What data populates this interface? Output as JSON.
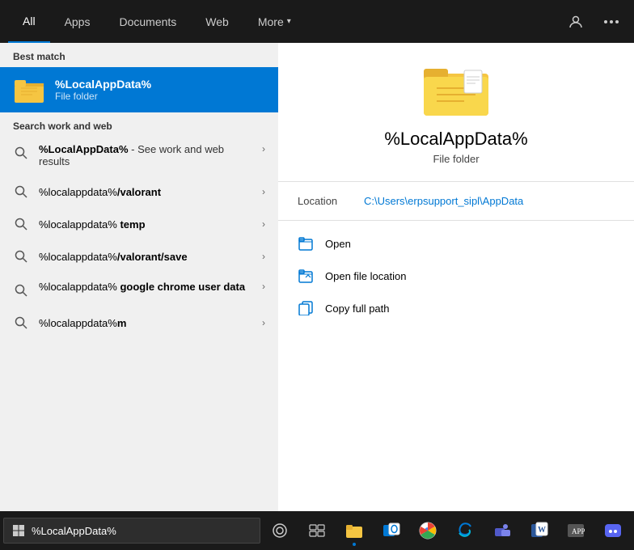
{
  "nav": {
    "tabs": [
      {
        "label": "All",
        "active": true
      },
      {
        "label": "Apps",
        "active": false
      },
      {
        "label": "Documents",
        "active": false
      },
      {
        "label": "Web",
        "active": false
      },
      {
        "label": "More",
        "active": false,
        "has_arrow": true
      }
    ],
    "icon_person": "👤",
    "icon_more": "···"
  },
  "best_match": {
    "section_label": "Best match",
    "item_name": "%LocalAppData%",
    "item_type": "File folder"
  },
  "search_section": {
    "label": "Search work and web",
    "items": [
      {
        "text": "%LocalAppData%",
        "suffix": " - See work and web results",
        "is_multi": true
      },
      {
        "text": "%localappdata%/valorant",
        "suffix": ""
      },
      {
        "text": "%localappdata% temp",
        "suffix": ""
      },
      {
        "text": "%localappdata%/valorant/save",
        "suffix": ""
      },
      {
        "text": "%localappdata% google chrome user data",
        "suffix": "",
        "bold_suffix": "google chrome user data",
        "is_multi": true
      },
      {
        "text": "%localappdata%m",
        "suffix": ""
      }
    ]
  },
  "right_panel": {
    "title": "%LocalAppData%",
    "subtitle": "File folder",
    "location_label": "Location",
    "location_path": "C:\\Users\\erpsupport_sipl\\AppData",
    "actions": [
      {
        "label": "Open",
        "icon_type": "folder-open"
      },
      {
        "label": "Open file location",
        "icon_type": "file-location"
      },
      {
        "label": "Copy full path",
        "icon_type": "copy-path"
      }
    ]
  },
  "taskbar": {
    "search_value": "%LocalAppData%",
    "search_placeholder": "%LocalAppData%"
  }
}
